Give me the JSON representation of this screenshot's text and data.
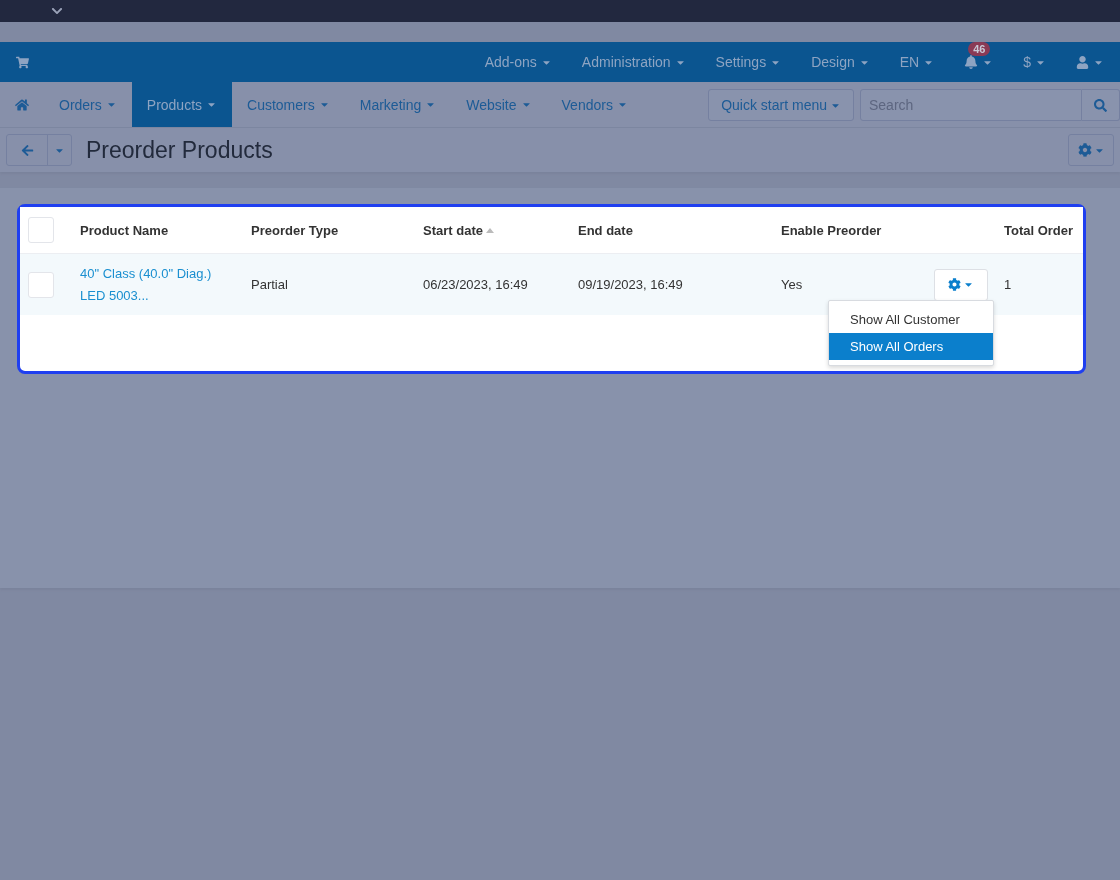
{
  "top_menu": [
    {
      "kind": "text",
      "label": "Add-ons"
    },
    {
      "kind": "text",
      "label": "Administration"
    },
    {
      "kind": "text",
      "label": "Settings"
    },
    {
      "kind": "text",
      "label": "Design"
    },
    {
      "kind": "text",
      "label": "EN"
    },
    {
      "kind": "bell",
      "badge": "46"
    },
    {
      "kind": "text",
      "label": "$"
    },
    {
      "kind": "user"
    }
  ],
  "nav": [
    {
      "label": "Orders",
      "selected": false
    },
    {
      "label": "Products",
      "selected": true
    },
    {
      "label": "Customers",
      "selected": false
    },
    {
      "label": "Marketing",
      "selected": false
    },
    {
      "label": "Website",
      "selected": false
    },
    {
      "label": "Vendors",
      "selected": false
    }
  ],
  "quick_start": "Quick start menu",
  "search": {
    "placeholder": "Search"
  },
  "page_title": "Preorder Products",
  "table": {
    "select_all_checked": false,
    "columns": [
      {
        "label": "Product Name",
        "sorted": false
      },
      {
        "label": "Preorder Type",
        "sorted": false
      },
      {
        "label": "Start date",
        "sorted": true
      },
      {
        "label": "End date",
        "sorted": false
      },
      {
        "label": "Enable Preorder",
        "sorted": false
      },
      {
        "label": "Total Order",
        "sorted": false
      }
    ],
    "rows": [
      {
        "checked": false,
        "product": "40\" Class (40.0\" Diag.) LED 5003...",
        "type": "Partial",
        "start": "06/23/2023, 16:49",
        "end": "09/19/2023, 16:49",
        "enabled": "Yes",
        "total": "1",
        "menu": [
          {
            "label": "Show All Customer",
            "selected": false
          },
          {
            "label": "Show All Orders",
            "selected": true
          }
        ]
      }
    ]
  }
}
